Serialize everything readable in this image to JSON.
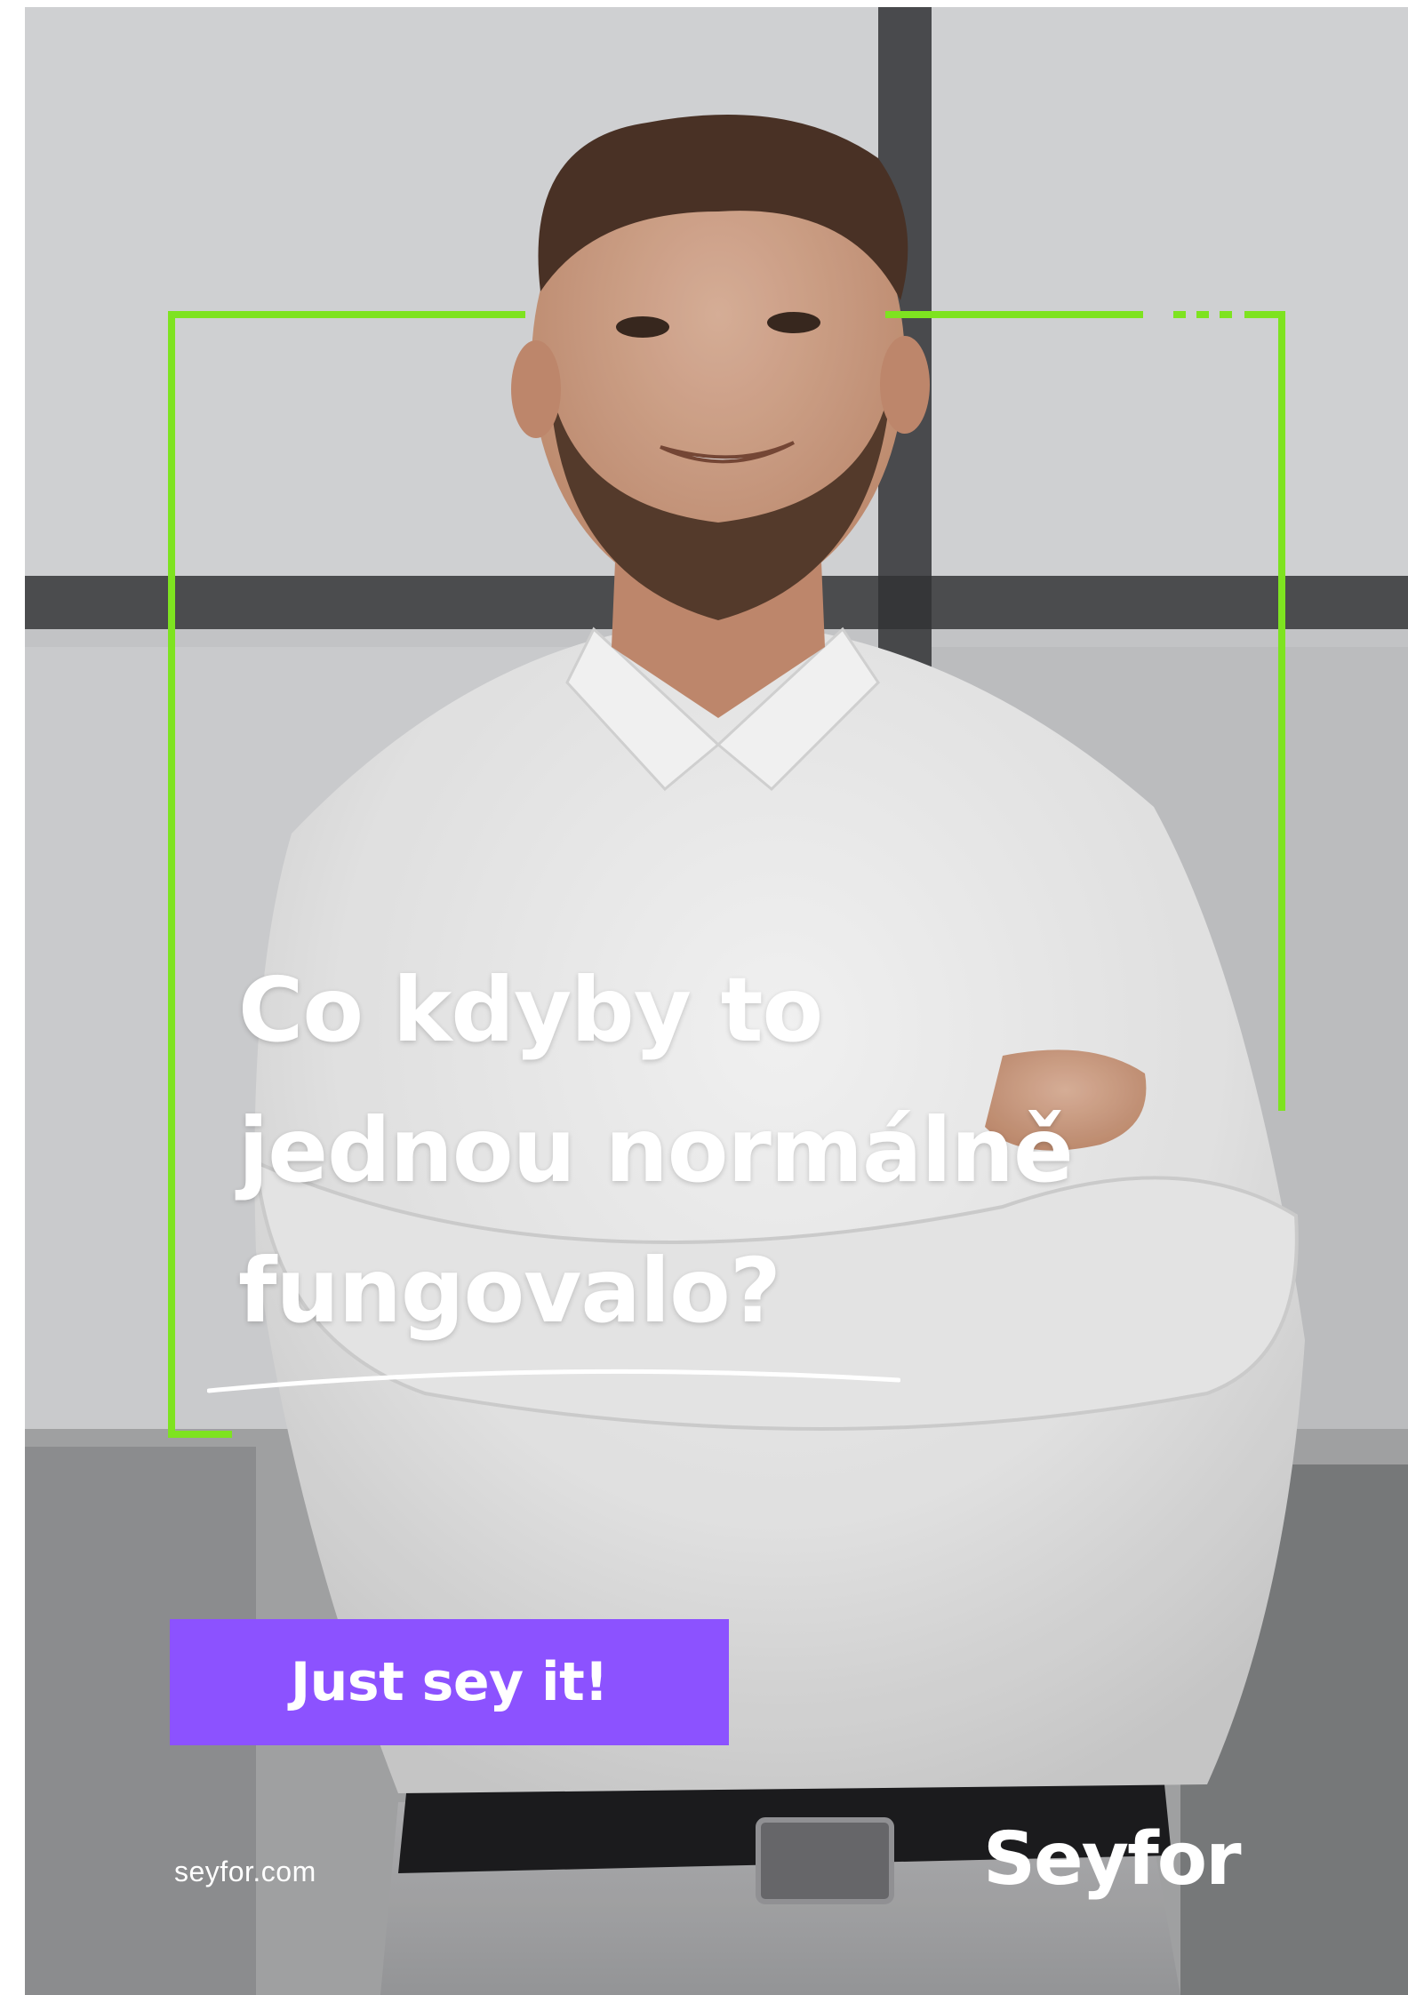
{
  "headline": {
    "line1": "Co kdyby to",
    "line2": "jednou normálně",
    "line3": "fungovalo?"
  },
  "cta": {
    "label": "Just sey it!"
  },
  "footer": {
    "website": "seyfor.com"
  },
  "brand": {
    "logo_text": "Seyfor"
  },
  "colors": {
    "accent_green": "#7ee320",
    "accent_purple": "#8c52ff",
    "text": "#ffffff"
  },
  "icons": [
    "underline-swoosh",
    "seyfor-logo"
  ]
}
